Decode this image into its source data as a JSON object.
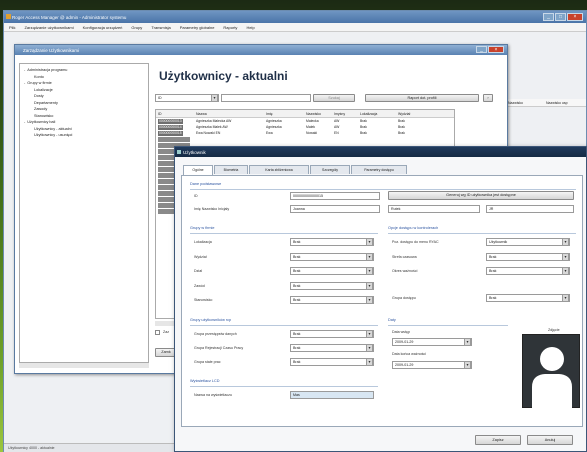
{
  "main_window": {
    "title": "Roger Access Manager @ admin - Administrator systemu",
    "menu": [
      "Plik",
      "Zarządzanie użytkownikami",
      "Konfiguracja urządzeń",
      "Grupy",
      "Transmisja",
      "Parametry globalne",
      "Raporty",
      "Help"
    ],
    "bg_headers": [
      "Nazwisko",
      "Nazwisko usp"
    ],
    "status_text": "Użytkownicy 4000 - aktualnie"
  },
  "browser_window": {
    "title": "Zarządzanie Użytkownikami",
    "tree": [
      {
        "label": "Administracja programu",
        "level": 0,
        "expander": "-"
      },
      {
        "label": "Konto",
        "level": 1
      },
      {
        "label": "Grupy w firmie",
        "level": 0,
        "expander": "-"
      },
      {
        "label": "Lokalizacje",
        "level": 1
      },
      {
        "label": "Dosty",
        "level": 1
      },
      {
        "label": "Departamenty",
        "level": 1
      },
      {
        "label": "Zawody",
        "level": 1
      },
      {
        "label": "Stanowisko",
        "level": 1
      },
      {
        "label": "Użytkownicy bali",
        "level": 0,
        "expander": "-"
      },
      {
        "label": "Użytkownicy - aktualni",
        "level": 1
      },
      {
        "label": "Użytkownicy - usunięci",
        "level": 1
      }
    ],
    "heading": "Użytkownicy - aktualni",
    "filter_field": "ID",
    "search_button": "Szukaj",
    "report_button": "Raport dot. profili",
    "columns": [
      "ID",
      "Nazwa",
      "Imię",
      "Nazwisko",
      "Imyśny",
      "Lokalizacja",
      "Wydział"
    ],
    "rows": [
      [
        "000000000013",
        "Agnieszka Malecka AW",
        "Agnieszka",
        "Malecka",
        "AW",
        "Brak",
        "Brak"
      ],
      [
        "000000000014",
        "Agnieszka Malek AW",
        "Agnieszka",
        "Malek",
        "AW",
        "Brak",
        "Brak"
      ],
      [
        "000000000015",
        "Ewa Nowaki EN",
        "Ewa",
        "Nowaki",
        "EN",
        "Brak",
        "Brak"
      ]
    ],
    "blank_rows": 13,
    "checkbox_label": "Zaz",
    "cancel_button": "Zamk"
  },
  "dialog": {
    "title": "Użytkownik",
    "tabs": [
      "Ogólne",
      "Biometria",
      "Karta zbliżeniowa",
      "Szczegóły",
      "Parametry dostępu"
    ],
    "personal": {
      "section": "Dane podstawowe",
      "id_label": "ID",
      "id_value": "000000000000015",
      "generate_button": "Generuj wg ID użytkownika jest dostępne",
      "name_label": "Imię Nazwisko Inicjały",
      "first_name": "Joanna",
      "last_name": "Rutek",
      "initials": "JR"
    },
    "company": {
      "section": "Grupy w firmie",
      "fields": [
        {
          "label": "Lokalizacja",
          "value": "Brak"
        },
        {
          "label": "Wydział",
          "value": "Brak"
        },
        {
          "label": "Dział",
          "value": "Brak"
        },
        {
          "label": "Zawód",
          "value": "Brak"
        },
        {
          "label": "Stanowisko",
          "value": "Brak"
        }
      ]
    },
    "access": {
      "section": "Opcje dostępu w kontrolerach",
      "fields": [
        {
          "label": "Poz. dostępu do menu RYAC",
          "value": "Użytkownik"
        },
        {
          "label": "Strefa czasowa",
          "value": "Brak"
        },
        {
          "label": "Okres ważności",
          "value": "Brak"
        }
      ],
      "group_label": "Grupa dostępu",
      "group_value": "Brak"
    },
    "rcp": {
      "section": "Grupy użytkowników rcp",
      "fields": [
        {
          "label": "Grupa przestępstw danych",
          "value": "Brak"
        },
        {
          "label": "Grupa Rejestracji Czasu Pracy",
          "value": "Brak"
        },
        {
          "label": "Grupa stałe prac",
          "value": "Brak"
        }
      ]
    },
    "lcd": {
      "section": "Wyświetlacz LCD",
      "label": "Nazwa na wyświetlaczu",
      "value": "Mas"
    },
    "dates": {
      "section": "Daty",
      "start_label": "Data wstęp",
      "start_value": "2009-01-29",
      "end_label": "Data końca ważności",
      "end_value": "2009-01-29"
    },
    "photo_label": "Zdjęcie",
    "ok_button": "Zapisz",
    "cancel_button": "Anuluj"
  }
}
